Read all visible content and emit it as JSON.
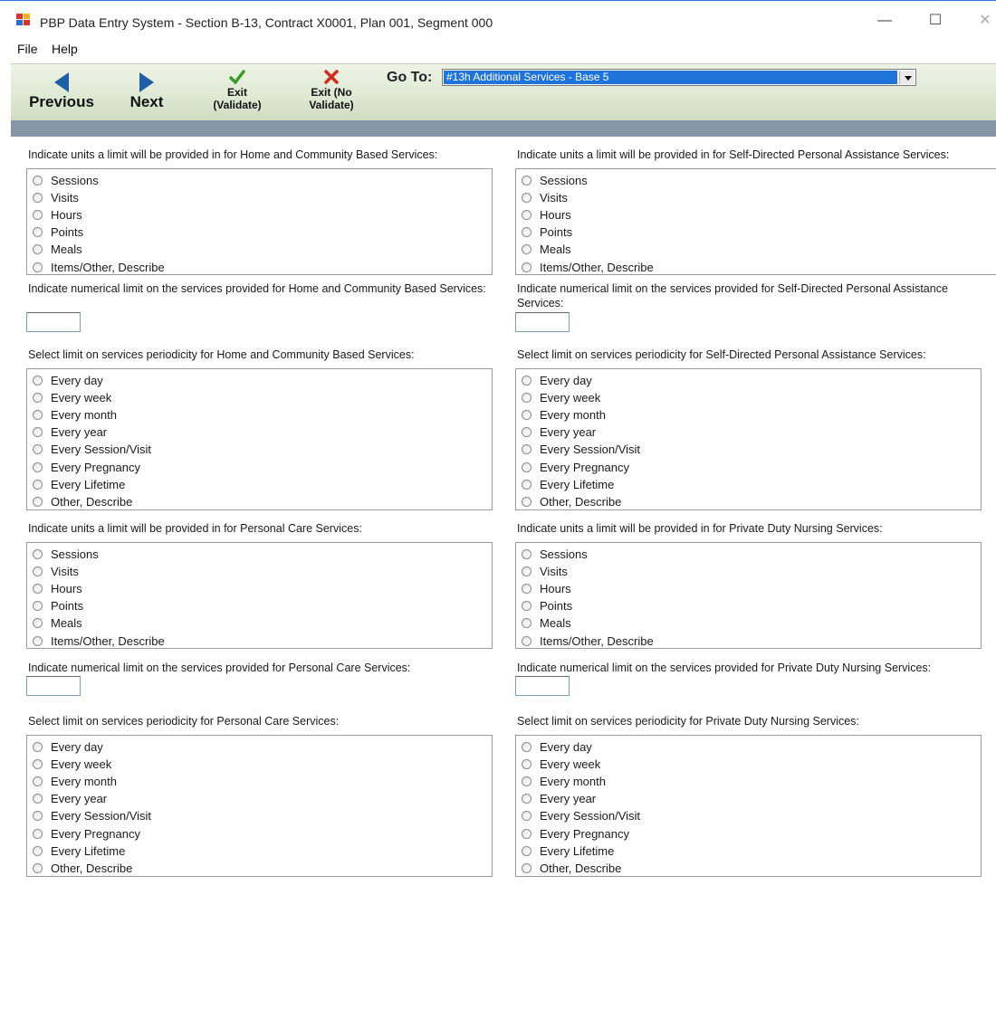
{
  "window": {
    "title": "PBP Data Entry System - Section B-13, Contract X0001, Plan 001, Segment 000",
    "controls": {
      "minimize": "—",
      "maximize": "☐",
      "close": "✕"
    },
    "accent": "#2b78d4"
  },
  "menu": {
    "file": "File",
    "help": "Help"
  },
  "toolbar": {
    "previous": "Previous",
    "next": "Next",
    "exit_validate_line1": "Exit",
    "exit_validate_line2": "(Validate)",
    "exit_novalidate_line1": "Exit (No",
    "exit_novalidate_line2": "Validate)",
    "goto_label": "Go To:",
    "goto_value": "#13h Additional Services - Base 5",
    "arrow_color": "#1f5fa8"
  },
  "options": {
    "units": [
      "Sessions",
      "Visits",
      "Hours",
      "Points",
      "Meals",
      "Items/Other, Describe"
    ],
    "periodicity": [
      "Every day",
      "Every week",
      "Every month",
      "Every year",
      "Every Session/Visit",
      "Every Pregnancy",
      "Every Lifetime",
      "Other, Describe"
    ]
  },
  "sections": {
    "hcbs": {
      "units_label": "Indicate units a limit will be provided in for Home and Community Based Services:",
      "limit_label": "Indicate numerical limit on the services provided for Home and Community Based Services:",
      "period_label": "Select limit on services periodicity for Home and Community Based Services:",
      "limit_value": ""
    },
    "sdpas": {
      "units_label": "Indicate units a limit will be provided in for Self-Directed Personal Assistance Services:",
      "limit_label": "Indicate numerical limit on the services provided for Self-Directed Personal Assistance Services:",
      "period_label": "Select limit on services periodicity for Self-Directed Personal Assistance Services:",
      "limit_value": ""
    },
    "pcs": {
      "units_label": "Indicate units a limit will be provided in for Personal Care Services:",
      "limit_label": "Indicate numerical limit on the services provided for Personal Care Services:",
      "period_label": "Select limit on services periodicity for Personal Care Services:",
      "limit_value": ""
    },
    "pdns": {
      "units_label": "Indicate units a limit will be provided in for Private Duty Nursing Services:",
      "limit_label": "Indicate numerical limit on the services provided for Private Duty Nursing Services:",
      "period_label": "Select limit on services periodicity for Private Duty Nursing Services:",
      "limit_value": ""
    }
  }
}
